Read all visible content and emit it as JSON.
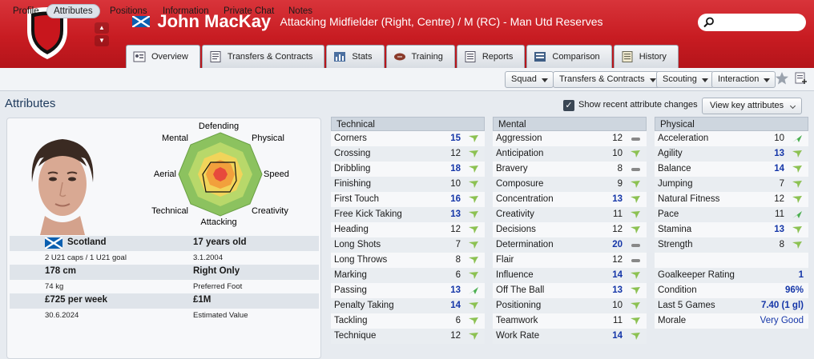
{
  "header": {
    "name": "John MacKay",
    "role": "Attacking Midfielder (Right, Centre) / M (RC) - Man Utd Reserves",
    "colors": {
      "header_red": "#c81c22",
      "highlight_blue": "#1536a8"
    }
  },
  "tabs": [
    {
      "label": "Overview",
      "icon": "profile-card-icon"
    },
    {
      "label": "Transfers & Contracts",
      "icon": "contract-icon"
    },
    {
      "label": "Stats",
      "icon": "stats-icon"
    },
    {
      "label": "Training",
      "icon": "rugby-ball-icon"
    },
    {
      "label": "Reports",
      "icon": "report-icon"
    },
    {
      "label": "Comparison",
      "icon": "comparison-icon"
    },
    {
      "label": "History",
      "icon": "history-icon"
    }
  ],
  "subnav": [
    "Profile",
    "Attributes",
    "Positions",
    "Information",
    "Private Chat",
    "Notes"
  ],
  "dropdowns": [
    "Squad",
    "Transfers & Contracts",
    "Scouting",
    "Interaction"
  ],
  "page_title": "Attributes",
  "show_recent_label": "Show recent attribute changes",
  "view_key_label": "View key attributes",
  "radar": {
    "labels": [
      "Defending",
      "Physical",
      "Speed",
      "Creativity",
      "Attacking",
      "Technical",
      "Aerial",
      "Mental"
    ]
  },
  "info": {
    "nation": "Scotland",
    "caps": "2 U21 caps / 1 U21 goal",
    "age": "17 years old",
    "dob": "3.1.2004",
    "height": "178 cm",
    "weight": "74 kg",
    "foot": "Right Only",
    "foot_label": "Preferred Foot",
    "wage": "£725 per week",
    "contract_end": "30.6.2024",
    "value": "£1M",
    "value_label": "Estimated Value"
  },
  "technical": {
    "title": "Technical",
    "rows": [
      {
        "label": "Corners",
        "value": "15",
        "trend": "up"
      },
      {
        "label": "Crossing",
        "value": "12",
        "trend": "up"
      },
      {
        "label": "Dribbling",
        "value": "18",
        "trend": "up"
      },
      {
        "label": "Finishing",
        "value": "10",
        "trend": "up"
      },
      {
        "label": "First Touch",
        "value": "16",
        "trend": "up"
      },
      {
        "label": "Free Kick Taking",
        "value": "13",
        "trend": "up"
      },
      {
        "label": "Heading",
        "value": "12",
        "trend": "up"
      },
      {
        "label": "Long Shots",
        "value": "7",
        "trend": "up"
      },
      {
        "label": "Long Throws",
        "value": "8",
        "trend": "up"
      },
      {
        "label": "Marking",
        "value": "6",
        "trend": "up"
      },
      {
        "label": "Passing",
        "value": "13",
        "trend": "up-strong"
      },
      {
        "label": "Penalty Taking",
        "value": "14",
        "trend": "up"
      },
      {
        "label": "Tackling",
        "value": "6",
        "trend": "up"
      },
      {
        "label": "Technique",
        "value": "12",
        "trend": "up"
      }
    ]
  },
  "mental": {
    "title": "Mental",
    "rows": [
      {
        "label": "Aggression",
        "value": "12",
        "trend": "flat"
      },
      {
        "label": "Anticipation",
        "value": "10",
        "trend": "up"
      },
      {
        "label": "Bravery",
        "value": "8",
        "trend": "flat"
      },
      {
        "label": "Composure",
        "value": "9",
        "trend": "up"
      },
      {
        "label": "Concentration",
        "value": "13",
        "trend": "up"
      },
      {
        "label": "Creativity",
        "value": "11",
        "trend": "up"
      },
      {
        "label": "Decisions",
        "value": "12",
        "trend": "up"
      },
      {
        "label": "Determination",
        "value": "20",
        "trend": "flat"
      },
      {
        "label": "Flair",
        "value": "12",
        "trend": "flat"
      },
      {
        "label": "Influence",
        "value": "14",
        "trend": "up"
      },
      {
        "label": "Off The Ball",
        "value": "13",
        "trend": "up"
      },
      {
        "label": "Positioning",
        "value": "10",
        "trend": "up"
      },
      {
        "label": "Teamwork",
        "value": "11",
        "trend": "up"
      },
      {
        "label": "Work Rate",
        "value": "14",
        "trend": "up"
      }
    ]
  },
  "physical": {
    "title": "Physical",
    "rows": [
      {
        "label": "Acceleration",
        "value": "10",
        "trend": "up-strong"
      },
      {
        "label": "Agility",
        "value": "13",
        "trend": "up"
      },
      {
        "label": "Balance",
        "value": "14",
        "trend": "up"
      },
      {
        "label": "Jumping",
        "value": "7",
        "trend": "up"
      },
      {
        "label": "Natural Fitness",
        "value": "12",
        "trend": "up"
      },
      {
        "label": "Pace",
        "value": "11",
        "trend": "up-strong"
      },
      {
        "label": "Stamina",
        "value": "13",
        "trend": "up"
      },
      {
        "label": "Strength",
        "value": "8",
        "trend": "up"
      }
    ],
    "extra": [
      {
        "label": "Goalkeeper Rating",
        "value": "1"
      },
      {
        "label": "Condition",
        "value": "96%"
      },
      {
        "label": "Last 5 Games",
        "value": "7.40 (1 gl)"
      },
      {
        "label": "Morale",
        "value": "Very Good"
      }
    ]
  }
}
